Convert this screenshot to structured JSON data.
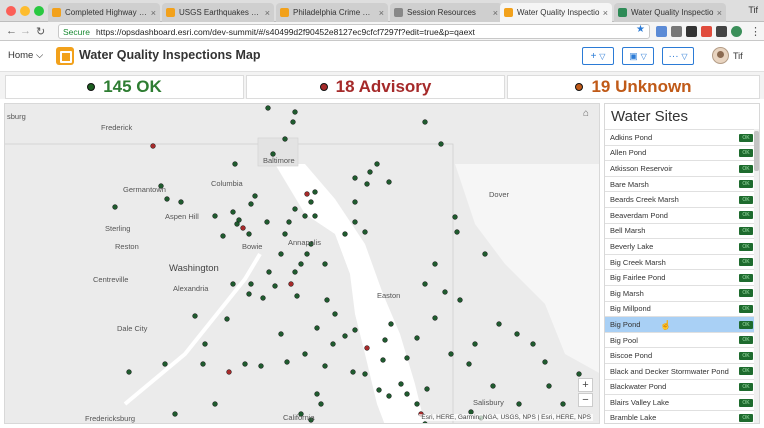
{
  "browser": {
    "tabs": [
      {
        "label": "Completed Highway Pro",
        "color": "#f2a11b"
      },
      {
        "label": "USGS Earthquakes Dash",
        "color": "#f2a11b"
      },
      {
        "label": "Philadelphia Crime Dash",
        "color": "#f2a11b"
      },
      {
        "label": "Session Resources",
        "color": "#888888"
      },
      {
        "label": "Water Quality Inspectio",
        "color": "#f2a11b"
      },
      {
        "label": "Water Quality Inspectio",
        "color": "#2e8b57"
      }
    ],
    "profile": "Tif",
    "secure_label": "Secure",
    "url": "https://opsdashboard.esri.com/dev-summit/#/s40499d2f90452e8127ec9cfcf7297f?edit=true&p=qaext"
  },
  "header": {
    "home_label": "Home",
    "title": "Water Quality Inspections Map",
    "user_name": "Tif"
  },
  "indicators": [
    {
      "value": "145 OK",
      "color": "#2e7d32",
      "dot": "#1b5e20"
    },
    {
      "value": "18 Advisory",
      "color": "#a52a2a",
      "dot": "#a52a2a"
    },
    {
      "value": "19 Unknown",
      "color": "#c05a18",
      "dot": "#c05a18"
    }
  ],
  "map": {
    "labels": [
      {
        "text": "Frederick"
      },
      {
        "text": "Baltimore"
      },
      {
        "text": "Germantown"
      },
      {
        "text": "Columbia"
      },
      {
        "text": "Aspen Hill"
      },
      {
        "text": "Sterling"
      },
      {
        "text": "Reston"
      },
      {
        "text": "Bowie"
      },
      {
        "text": "Annapolis"
      },
      {
        "text": "Washington"
      },
      {
        "text": "Alexandria"
      },
      {
        "text": "Centreville"
      },
      {
        "text": "Dale City"
      },
      {
        "text": "Dover"
      },
      {
        "text": "Easton"
      },
      {
        "text": "Fredericksburg"
      },
      {
        "text": "California"
      },
      {
        "text": "Salisbury"
      },
      {
        "text": "sburg"
      }
    ],
    "attribution": "Esri, HERE, Garmin, NGA, USGS, NPS | Esri, HERE, NPS",
    "zoom_in": "+",
    "zoom_out": "−"
  },
  "panel": {
    "title": "Water Sites",
    "selected_index": 12,
    "badge": "OK",
    "items": [
      "Adkins Pond",
      "Allen Pond",
      "Atkisson Reservoir",
      "Bare Marsh",
      "Beards Creek Marsh",
      "Beaverdam Pond",
      "Bell Marsh",
      "Beverly Lake",
      "Big Creek Marsh",
      "Big Fairlee Pond",
      "Big Marsh",
      "Big Millpond",
      "Big Pond",
      "Big Pool",
      "Biscoe Pond",
      "Black and Decker Stormwater Pond",
      "Blackwater Pond",
      "Blairs Valley Lake",
      "Bramble Lake"
    ]
  }
}
